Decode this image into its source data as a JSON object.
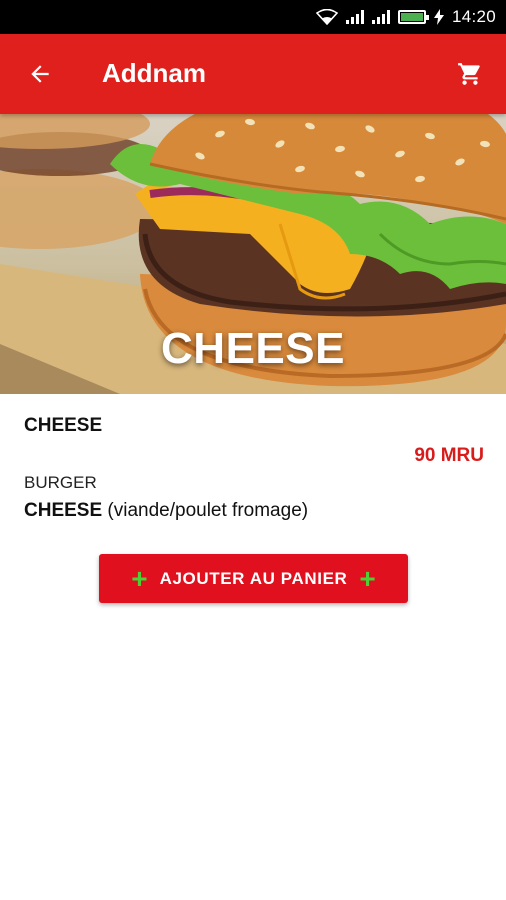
{
  "status_bar": {
    "time": "14:20",
    "icons": [
      "wifi-icon",
      "signal-icon",
      "signal-icon",
      "battery-icon",
      "charging-icon"
    ]
  },
  "app_bar": {
    "title": "Addnam",
    "back_icon": "arrow-left-icon",
    "cart_icon": "cart-icon"
  },
  "hero": {
    "overlay_title": "CHEESE",
    "image_subject": "cheeseburger"
  },
  "product": {
    "name": "CHEESE",
    "price": "90 MRU",
    "category": "BURGER",
    "description_bold": "CHEESE",
    "description_rest": " (viande/poulet fromage)"
  },
  "actions": {
    "add_to_cart_label": "AJOUTER AU PANIER",
    "plus_icon": "plus-icon"
  },
  "colors": {
    "primary": "#e0201c",
    "button": "#e0101e",
    "price": "#d81c1c",
    "plus": "#4cd137"
  }
}
